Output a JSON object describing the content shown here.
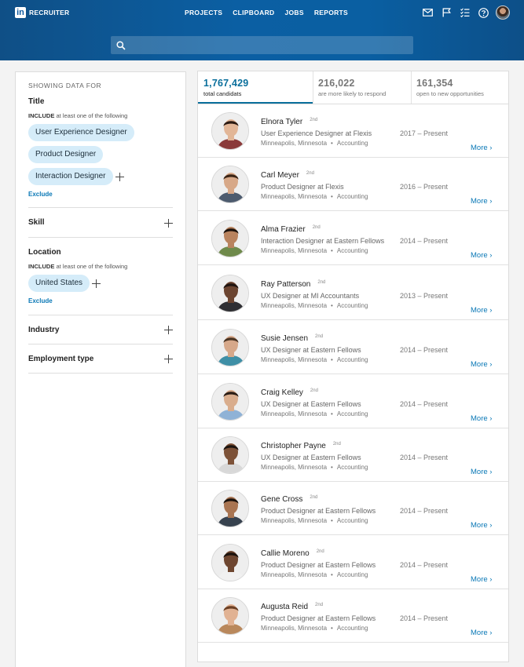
{
  "header": {
    "logo_letters": "in",
    "product": "RECRUITER",
    "nav": [
      "PROJECTS",
      "CLIPBOARD",
      "JOBS",
      "REPORTS"
    ],
    "icons": [
      "mail-icon",
      "flag-icon",
      "tasks-icon",
      "help-icon"
    ],
    "search": {
      "value": "",
      "placeholder": ""
    }
  },
  "filters": {
    "heading": "SHOWING DATA FOR",
    "title": {
      "label": "Title",
      "include_bold": "INCLUDE",
      "include_rest": "at least one of the following",
      "chips": [
        "User Experience Designer",
        "Product Designer",
        "Interaction Designer"
      ],
      "exclude": "Exclude"
    },
    "skill": {
      "label": "Skill"
    },
    "location": {
      "label": "Location",
      "include_bold": "INCLUDE",
      "include_rest": "at least one of the following",
      "chips": [
        "United States"
      ],
      "exclude": "Exclude"
    },
    "industry": {
      "label": "Industry"
    },
    "employment": {
      "label": "Employment type"
    }
  },
  "stats": [
    {
      "value": "1,767,429",
      "label": "total candidats",
      "active": true
    },
    {
      "value": "216,022",
      "label": "are more likely to respond",
      "active": false
    },
    {
      "value": "161,354",
      "label": "open to new opportunities",
      "active": false
    }
  ],
  "candidates": [
    {
      "name": "Elnora Tyler",
      "degree": "2nd",
      "role": "User Experience Designer",
      "at": "at",
      "company": "Flexis",
      "city": "Minneapolis, Minnesota",
      "sep": "•",
      "industry": "Accounting",
      "dates": "2017 – Present",
      "more": "More ›",
      "skin": "#e2b697",
      "hair": "#2b1a12",
      "shirt": "#8a3a3a"
    },
    {
      "name": "Carl Meyer",
      "degree": "2nd",
      "role": "Product Designer",
      "at": "at",
      "company": "Flexis",
      "city": "Minneapolis, Minnesota",
      "sep": "•",
      "industry": "Accounting",
      "dates": "2016 – Present",
      "more": "More ›",
      "skin": "#d7a888",
      "hair": "#3b2516",
      "shirt": "#4d5b6e"
    },
    {
      "name": "Alma Frazier",
      "degree": "2nd",
      "role": "Interaction Designer",
      "at": "at",
      "company": "Eastern Fellows",
      "city": "Minneapolis, Minnesota",
      "sep": "•",
      "industry": "Accounting",
      "dates": "2014 – Present",
      "more": "More ›",
      "skin": "#b9835e",
      "hair": "#1c120c",
      "shirt": "#6f8a4b"
    },
    {
      "name": "Ray Patterson",
      "degree": "2nd",
      "role": "UX Designer",
      "at": "at",
      "company": "MI Accountants",
      "city": "Minneapolis, Minnesota",
      "sep": "•",
      "industry": "Accounting",
      "dates": "2013 – Present",
      "more": "More ›",
      "skin": "#6b4430",
      "hair": "#1f1410",
      "shirt": "#2f2f33"
    },
    {
      "name": "Susie Jensen",
      "degree": "2nd",
      "role": "UX Designer",
      "at": "at",
      "company": "Eastern Fellows",
      "city": "Minneapolis, Minnesota",
      "sep": "•",
      "industry": "Accounting",
      "dates": "2014 – Present",
      "more": "More ›",
      "skin": "#d6a88a",
      "hair": "#4a3423",
      "shirt": "#3f8fa6"
    },
    {
      "name": "Craig Kelley",
      "degree": "2nd",
      "role": "UX Designer",
      "at": "at",
      "company": "Eastern Fellows",
      "city": "Minneapolis, Minnesota",
      "sep": "•",
      "industry": "Accounting",
      "dates": "2014 – Present",
      "more": "More ›",
      "skin": "#d9ad8d",
      "hair": "#2a1d15",
      "shirt": "#8fb2d6"
    },
    {
      "name": "Christopher Payne",
      "degree": "2nd",
      "role": "UX Designer",
      "at": "at",
      "company": "Eastern Fellows",
      "city": "Minneapolis, Minnesota",
      "sep": "•",
      "industry": "Accounting",
      "dates": "2014 – Present",
      "more": "More ›",
      "skin": "#7d5238",
      "hair": "#1c140f",
      "shirt": "#d8d8d8"
    },
    {
      "name": "Gene Cross",
      "degree": "2nd",
      "role": "Product Designer",
      "at": "at",
      "company": "Eastern Fellows",
      "city": "Minneapolis, Minnesota",
      "sep": "•",
      "industry": "Accounting",
      "dates": "2014 – Present",
      "more": "More ›",
      "skin": "#a97552",
      "hair": "#1a120d",
      "shirt": "#37424f"
    },
    {
      "name": "Callie Moreno",
      "degree": "2nd",
      "role": "Product Designer",
      "at": "at",
      "company": "Eastern Fellows",
      "city": "Minneapolis, Minnesota",
      "sep": "•",
      "industry": "Accounting",
      "dates": "2014 – Present",
      "more": "More ›",
      "skin": "#6e4630",
      "hair": "#1b120d",
      "shirt": "#f1f1f1"
    },
    {
      "name": "Augusta Reid",
      "degree": "2nd",
      "role": "Product Designer",
      "at": "at",
      "company": "Eastern Fellows",
      "city": "Minneapolis, Minnesota",
      "sep": "•",
      "industry": "Accounting",
      "dates": "2014 – Present",
      "more": "More ›",
      "skin": "#e1b293",
      "hair": "#6a3f24",
      "shirt": "#b9885c"
    }
  ],
  "colors": {
    "header_blue": "#0b5fa3",
    "accent": "#0a6f9c",
    "link": "#0a78b6",
    "chip_bg": "#d5ecf9"
  }
}
